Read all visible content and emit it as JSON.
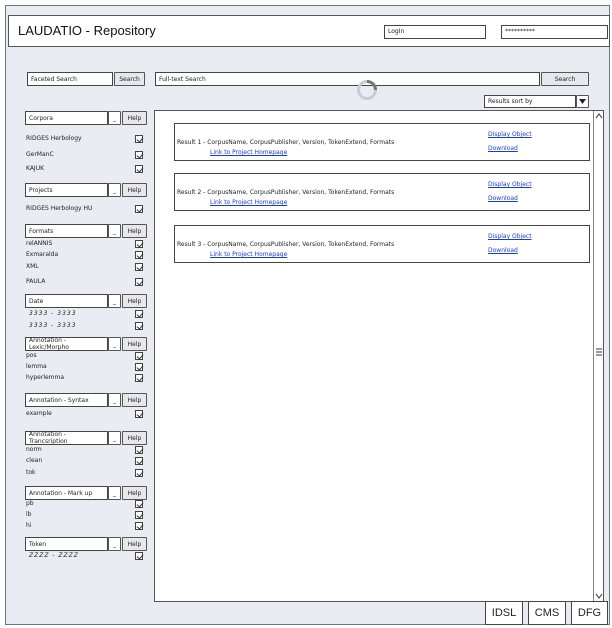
{
  "header": {
    "title": "LAUDATIO - Repository",
    "login_value": "LogIn",
    "password_value": "**********"
  },
  "faceted_search": {
    "label": "Faceted Search",
    "button": "Search"
  },
  "fulltext_search": {
    "placeholder": "Full-text Search",
    "button": "Search"
  },
  "sort": {
    "label": "Results sort by"
  },
  "facets": {
    "corpora": {
      "title": "Corpora",
      "minimize": "_",
      "help": "Help",
      "items": [
        "RIDGES Herbology",
        "GerManC",
        "KAJUK"
      ]
    },
    "projects": {
      "title": "Projects",
      "minimize": "_",
      "help": "Help",
      "items": [
        "RIDGES Herbology HU"
      ]
    },
    "formats": {
      "title": "Formats",
      "minimize": "_",
      "help": "Help",
      "items": [
        "relANNIS",
        "Exmaralda",
        "XML",
        "PAULA"
      ]
    },
    "date": {
      "title": "Date",
      "minimize": "_",
      "help": "Help",
      "items": [
        "3333   -   3333",
        "3333   -   3333"
      ]
    },
    "lexic": {
      "title": "Annotation - Lexic/Morpho",
      "minimize": "_",
      "help": "Help",
      "items": [
        "pos",
        "lemma",
        "hyperlemma"
      ]
    },
    "syntax": {
      "title": "Annotation - Syntax",
      "minimize": "_",
      "help": "Help",
      "items": [
        "example"
      ]
    },
    "transcription": {
      "title": "Annotation - Trancsription",
      "minimize": "_",
      "help": "Help",
      "items": [
        "norm",
        "clean",
        "tok"
      ]
    },
    "markup": {
      "title": "Annotation - Mark up",
      "minimize": "_",
      "help": "Help",
      "items": [
        "pb",
        "lb",
        "hi"
      ]
    },
    "token": {
      "title": "Token",
      "minimize": "_",
      "help": "Help",
      "items": [
        "ZZZZ   -   ZZZZ"
      ]
    }
  },
  "results": [
    {
      "text": "Result 1 - CorpusName, CorpusPublisher, Version, TokenExtend, Formats",
      "project_link": "Link to Project Homepage",
      "display": "Display Object",
      "download": "Download"
    },
    {
      "text": "Result 2 - CorpusName, CorpusPublisher, Version, TokenExtend, Formats",
      "project_link": "Link to Project Homepage",
      "display": "Display Object",
      "download": "Download"
    },
    {
      "text": "Result 3 - CorpusName, CorpusPublisher, Version, TokenExtend, Formats",
      "project_link": "Link to Project Homepage",
      "display": "Display Object",
      "download": "Download"
    }
  ],
  "footer": {
    "logos": [
      "IDSL",
      "CMS",
      "DFG"
    ]
  }
}
